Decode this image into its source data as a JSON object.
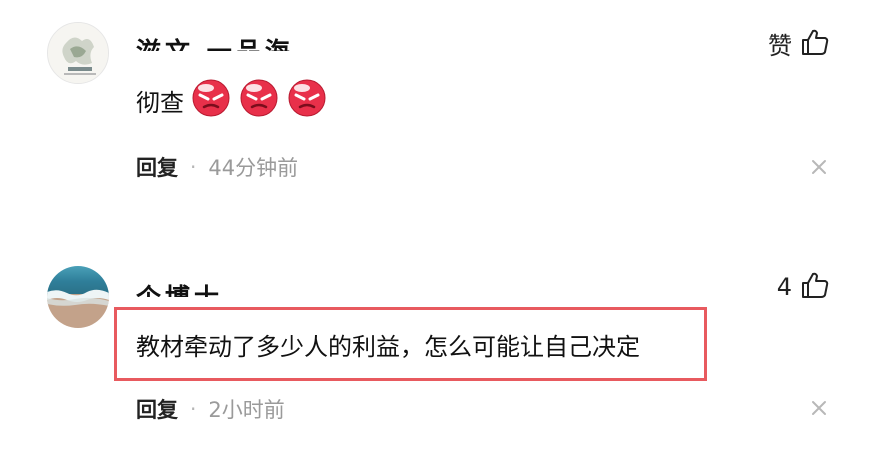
{
  "comments": [
    {
      "username": "滋文 一品海",
      "like_label": "赞",
      "text": "彻查",
      "emojis": [
        "angry-face",
        "angry-face",
        "angry-face"
      ],
      "reply_label": "回复",
      "separator": "·",
      "time": "44分钟前"
    },
    {
      "username": "个博士",
      "like_label": "4",
      "text": "教材牵动了多少人的利益，怎么可能让自己决定",
      "reply_label": "回复",
      "separator": "·",
      "time": "2小时前"
    }
  ],
  "colors": {
    "highlight_border": "#e85a5f",
    "time_text": "#9a9a9a",
    "emoji_red": "#e8304a"
  },
  "icons": [
    "thumb-up-icon",
    "close-icon",
    "angry-face-emoji"
  ]
}
